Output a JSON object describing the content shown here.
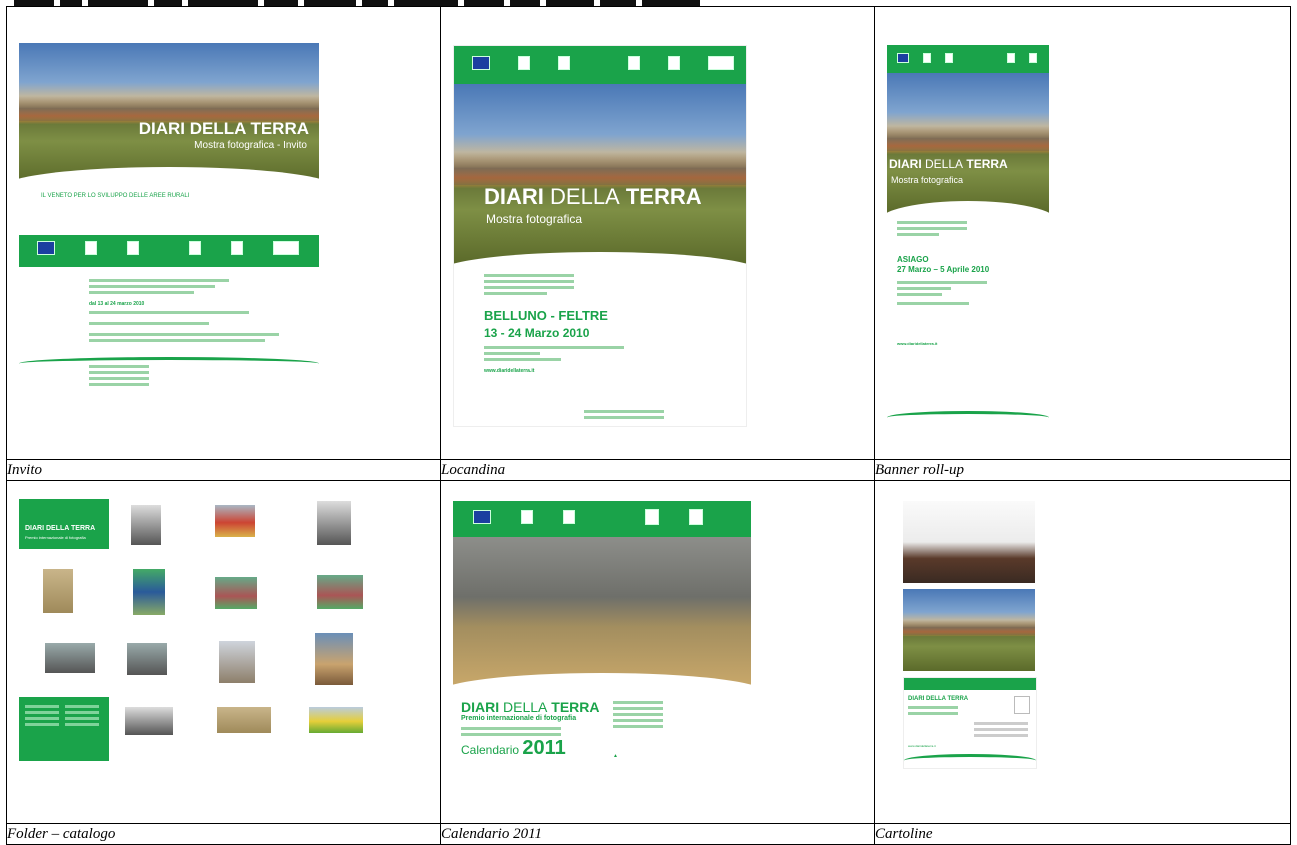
{
  "captions": {
    "invito": "Invito",
    "locandina": "Locandina",
    "banner": "Banner roll-up",
    "folder": "Folder – catalogo",
    "calendario": "Calendario 2011",
    "cartoline": "Cartoline"
  },
  "invito": {
    "title_a": "DIARI DELLA TERRA",
    "subtitle": "Mostra fotografica - Invito",
    "footer": "IL VENETO PER LO SVILUPPO DELLE AREE RURALI",
    "date_line": "dal 13 al 24 marzo 2010"
  },
  "locandina": {
    "title_bold": "DIARI",
    "title_light": "DELLA",
    "title_bold2": "TERRA",
    "subtitle": "Mostra fotografica",
    "place": "BELLUNO - FELTRE",
    "dates": "13 - 24 Marzo 2010",
    "url": "www.diaridellaterra.it"
  },
  "banner": {
    "title_bold": "DIARI",
    "title_light": "DELLA",
    "title_bold2": "TERRA",
    "subtitle": "Mostra fotografica",
    "place": "ASIAGO",
    "dates": "27 Marzo – 5 Aprile 2010",
    "url": "www.diaridellaterra.it"
  },
  "folder": {
    "title": "DIARI DELLA TERRA",
    "subtitle": "Premio internazionale di fotografia"
  },
  "calendario": {
    "title_bold": "DIARI",
    "title_light": "DELLA",
    "title_bold2": "TERRA",
    "subtitle": "Premio internazionale di fotografia",
    "label": "Calendario",
    "year": "2011"
  },
  "cartoline": {
    "title": "DIARI DELLA TERRA",
    "url": "www.diaridellaterra.it"
  },
  "colors": {
    "green": "#1aa34a",
    "border": "#000000"
  }
}
